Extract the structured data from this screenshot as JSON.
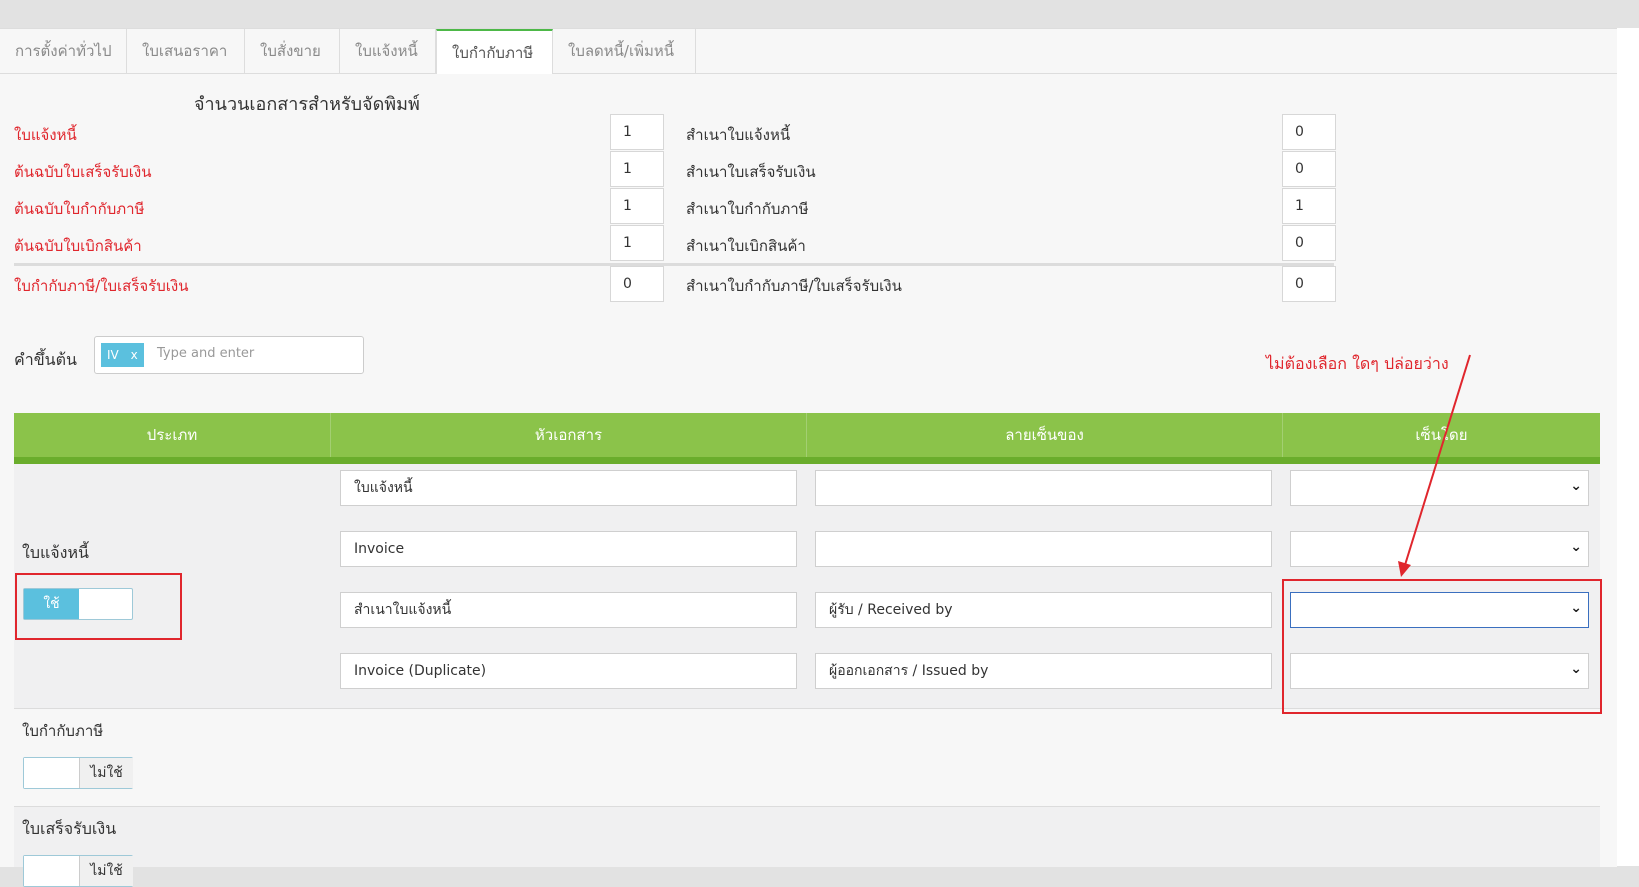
{
  "tabs": [
    "การตั้งค่าทั่วไป",
    "ใบเสนอราคา",
    "ใบสั่งขาย",
    "ใบแจ้งหนี้",
    "ใบกำกับภาษี",
    "ใบลดหนี้/เพิ่มหนี้"
  ],
  "active_tab": "ใบกำกับภาษี",
  "print_section": {
    "title": "จำนวนเอกสารสำหรับจัดพิมพ์",
    "rows": [
      {
        "left_label": "ใบแจ้งหนี้",
        "left_value": "1",
        "right_label": "สำเนาใบแจ้งหนี้",
        "right_value": "0"
      },
      {
        "left_label": "ต้นฉบับใบเสร็จรับเงิน",
        "left_value": "1",
        "right_label": "สำเนาใบเสร็จรับเงิน",
        "right_value": "0"
      },
      {
        "left_label": "ต้นฉบับใบกำกับภาษี",
        "left_value": "1",
        "right_label": "สำเนาใบกำกับภาษี",
        "right_value": "1"
      },
      {
        "left_label": "ต้นฉบับใบเบิกสินค้า",
        "left_value": "1",
        "right_label": "สำเนาใบเบิกสินค้า",
        "right_value": "0"
      },
      {
        "left_label": "ใบกำกับภาษี/ใบเสร็จรับเงิน",
        "left_value": "0",
        "right_label": "สำเนาใบกำกับภาษี/ใบเสร็จรับเงิน",
        "right_value": "0"
      }
    ]
  },
  "prefix": {
    "label": "คำขึ้นต้น",
    "tag": "IV",
    "tag_remove": "x",
    "placeholder": "Type and enter"
  },
  "annotation": "ไม่ต้องเลือก ใดๆ ปล่อยว่าง",
  "table": {
    "headers": [
      "ประเภท",
      "หัวเอกสาร",
      "ลายเซ็นของ",
      "เซ็นโดย"
    ],
    "groups": [
      {
        "name": "ใบแจ้งหนี้",
        "toggle": "ใช้",
        "rows": [
          {
            "title": "ใบแจ้งหนี้",
            "signature": ""
          },
          {
            "title": "Invoice",
            "signature": ""
          },
          {
            "title": "สำเนาใบแจ้งหนี้",
            "signature": "ผู้รับ / Received by"
          },
          {
            "title": "Invoice (Duplicate)",
            "signature": "ผู้ออกเอกสาร / Issued by"
          }
        ]
      },
      {
        "name": "ใบกำกับภาษี",
        "toggle": "ไม่ใช้"
      },
      {
        "name": "ใบเสร็จรับเงิน",
        "toggle": "ไม่ใช้"
      }
    ]
  },
  "colors": {
    "accent_green": "#8bc34a",
    "toggle_blue": "#5bc0de",
    "annotation_red": "#e0262d"
  }
}
